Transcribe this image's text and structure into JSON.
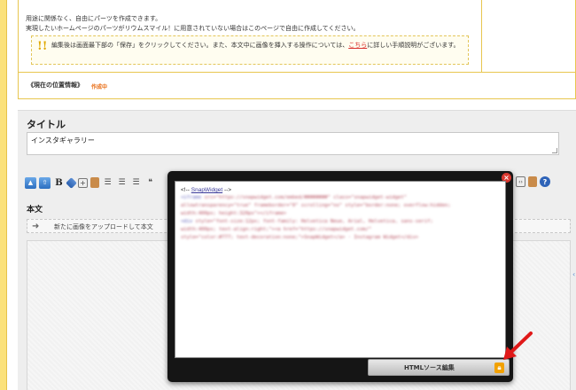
{
  "top_panel": {
    "info_line_1": "用途に関係なく、自由にパーツを作成できます。",
    "info_line_2": "実現したいホームページのパーツがリウムスマイル！に用意されていない場合はこのページで自由に作成してください。",
    "notice_before_link": "編集後は画面最下部の「保存」をクリックしてください。また、本文中に画像を挿入する操作については、",
    "notice_link": "こちら",
    "notice_after_link": "に詳しい手順説明がございます。",
    "location_label": "《現在の位置情報》",
    "location_status": "作成中"
  },
  "editor": {
    "title_label": "タイトル",
    "title_value": "インスタギャラリー",
    "body_label": "本文",
    "upload_text": "新たに画像をアップロードして本文",
    "toolbar_icons": [
      "image-icon",
      "upload-icon",
      "bold-icon",
      "eraser-icon",
      "insert-box-icon",
      "paste-icon",
      "bulleted-list-icon",
      "numbered-list-icon",
      "list-icon",
      "quote-icon"
    ],
    "toolbar_right_icons": [
      "source-icon",
      "paste-icon",
      "help-icon"
    ]
  },
  "modal": {
    "close_glyph": "×",
    "first_line_prefix": "<!-- ",
    "first_line_tag": "SnapWidget",
    "first_line_suffix": " -->",
    "source_button_label": "HTMLソース編集"
  },
  "colors": {
    "frame_yellow": "#e8c64f",
    "link_red": "#d9302c",
    "status_orange": "#e86a10",
    "modal_bg": "#151515",
    "pointer_red": "#e01919"
  }
}
